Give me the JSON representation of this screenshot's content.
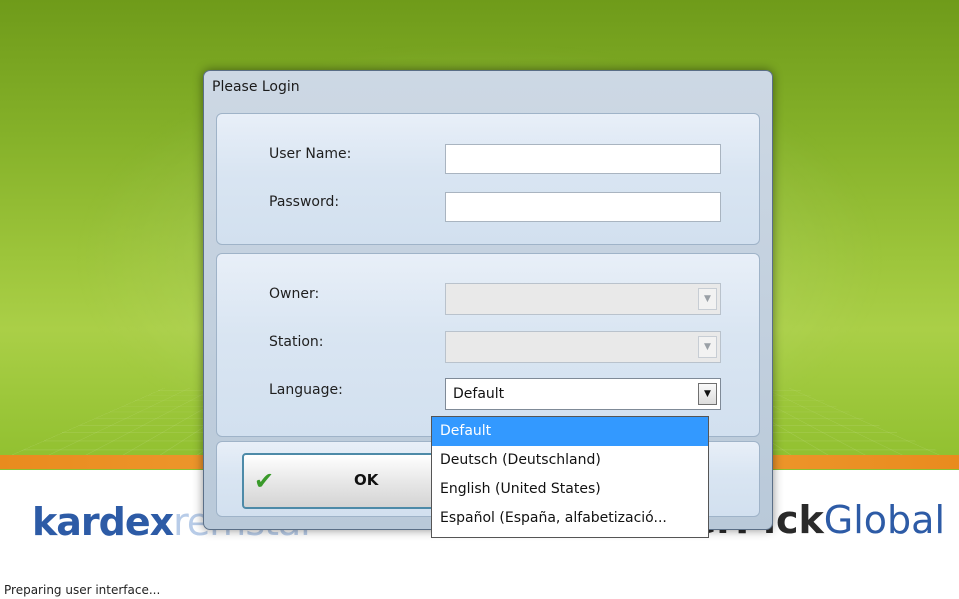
{
  "dialog": {
    "title": "Please Login"
  },
  "fields": {
    "user_name_label": "User Name:",
    "user_name_value": "",
    "password_label": "Password:",
    "password_value": "",
    "owner_label": "Owner:",
    "owner_value": "",
    "station_label": "Station:",
    "station_value": "",
    "language_label": "Language:",
    "language_value": "Default"
  },
  "language_options": [
    "Default",
    "Deutsch (Deutschland)",
    "English (United States)",
    "Español (España, alfabetizació..."
  ],
  "buttons": {
    "ok_label": "OK"
  },
  "brand": {
    "left_bold": "kardex",
    "left_light": "remstar",
    "right_bold": "PowerPick",
    "right_light": "Global"
  },
  "status_text": "Preparing user interface...",
  "colors": {
    "selection": "#3399ff",
    "brand_blue": "#2d5ba6",
    "splash_green": "#8fbf2e",
    "accent_orange": "#f2a33c"
  },
  "icons": {
    "ok": "checkmark-icon",
    "dropdown": "chevron-down-icon"
  }
}
